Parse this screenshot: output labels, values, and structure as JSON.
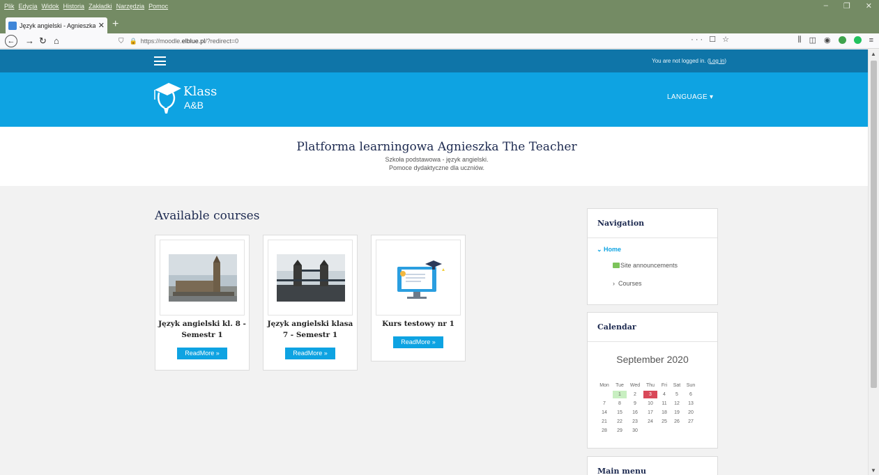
{
  "browser": {
    "menu": [
      "Plik",
      "Edycja",
      "Widok",
      "Historia",
      "Zakładki",
      "Narzędzia",
      "Pomoc"
    ],
    "tab_title": "Język angielski - Agnieszka The Teacher",
    "new_tab": "+",
    "url_prefix": "https://moodle.",
    "url_domain": "elblue.pl",
    "url_path": "/?redirect=0",
    "url_actions": "··· ☐ ☆",
    "win_controls": [
      "–",
      "❐",
      "✕"
    ]
  },
  "topbar": {
    "login_text": "You are not logged in. (",
    "login_link": "Log in",
    "login_close": ")"
  },
  "header": {
    "logo_line1": "Klass",
    "logo_line2": "A&B",
    "language": "LANGUAGE ▾"
  },
  "intro": {
    "title": "Platforma learningowa Agnieszka The Teacher",
    "sub1": "Szkoła podstawowa - język angielski.",
    "sub2": "Pomoce dydaktyczne dla uczniów."
  },
  "courses": {
    "title": "Available courses",
    "items": [
      {
        "name": "Język angielski kl. 8 - Semestr 1",
        "button": "ReadMore »"
      },
      {
        "name": "Język angielski klasa 7 - Semestr 1",
        "button": "ReadMore »"
      },
      {
        "name": "Kurs testowy nr 1",
        "button": "ReadMore »"
      }
    ]
  },
  "navigation": {
    "title": "Navigation",
    "home": "Home",
    "site_announcements": "Site announcements",
    "courses": "Courses"
  },
  "calendar": {
    "title": "Calendar",
    "month": "September 2020",
    "weekdays": [
      "Mon",
      "Tue",
      "Wed",
      "Thu",
      "Fri",
      "Sat",
      "Sun"
    ],
    "weeks": [
      [
        "",
        "1",
        "2",
        "3",
        "4",
        "5",
        "6"
      ],
      [
        "7",
        "8",
        "9",
        "10",
        "11",
        "12",
        "13"
      ],
      [
        "14",
        "15",
        "16",
        "17",
        "18",
        "19",
        "20"
      ],
      [
        "21",
        "22",
        "23",
        "24",
        "25",
        "26",
        "27"
      ],
      [
        "28",
        "29",
        "30",
        "",
        "",
        "",
        ""
      ]
    ],
    "highlight_green": "1",
    "highlight_red": "3",
    "green_color": "#c8efc1",
    "red_color": "#d94959"
  },
  "main_menu": {
    "title": "Main menu"
  },
  "colors": {
    "topbar": "#0f75a8",
    "header": "#0ea3e2",
    "browser_chrome": "#748b64"
  }
}
